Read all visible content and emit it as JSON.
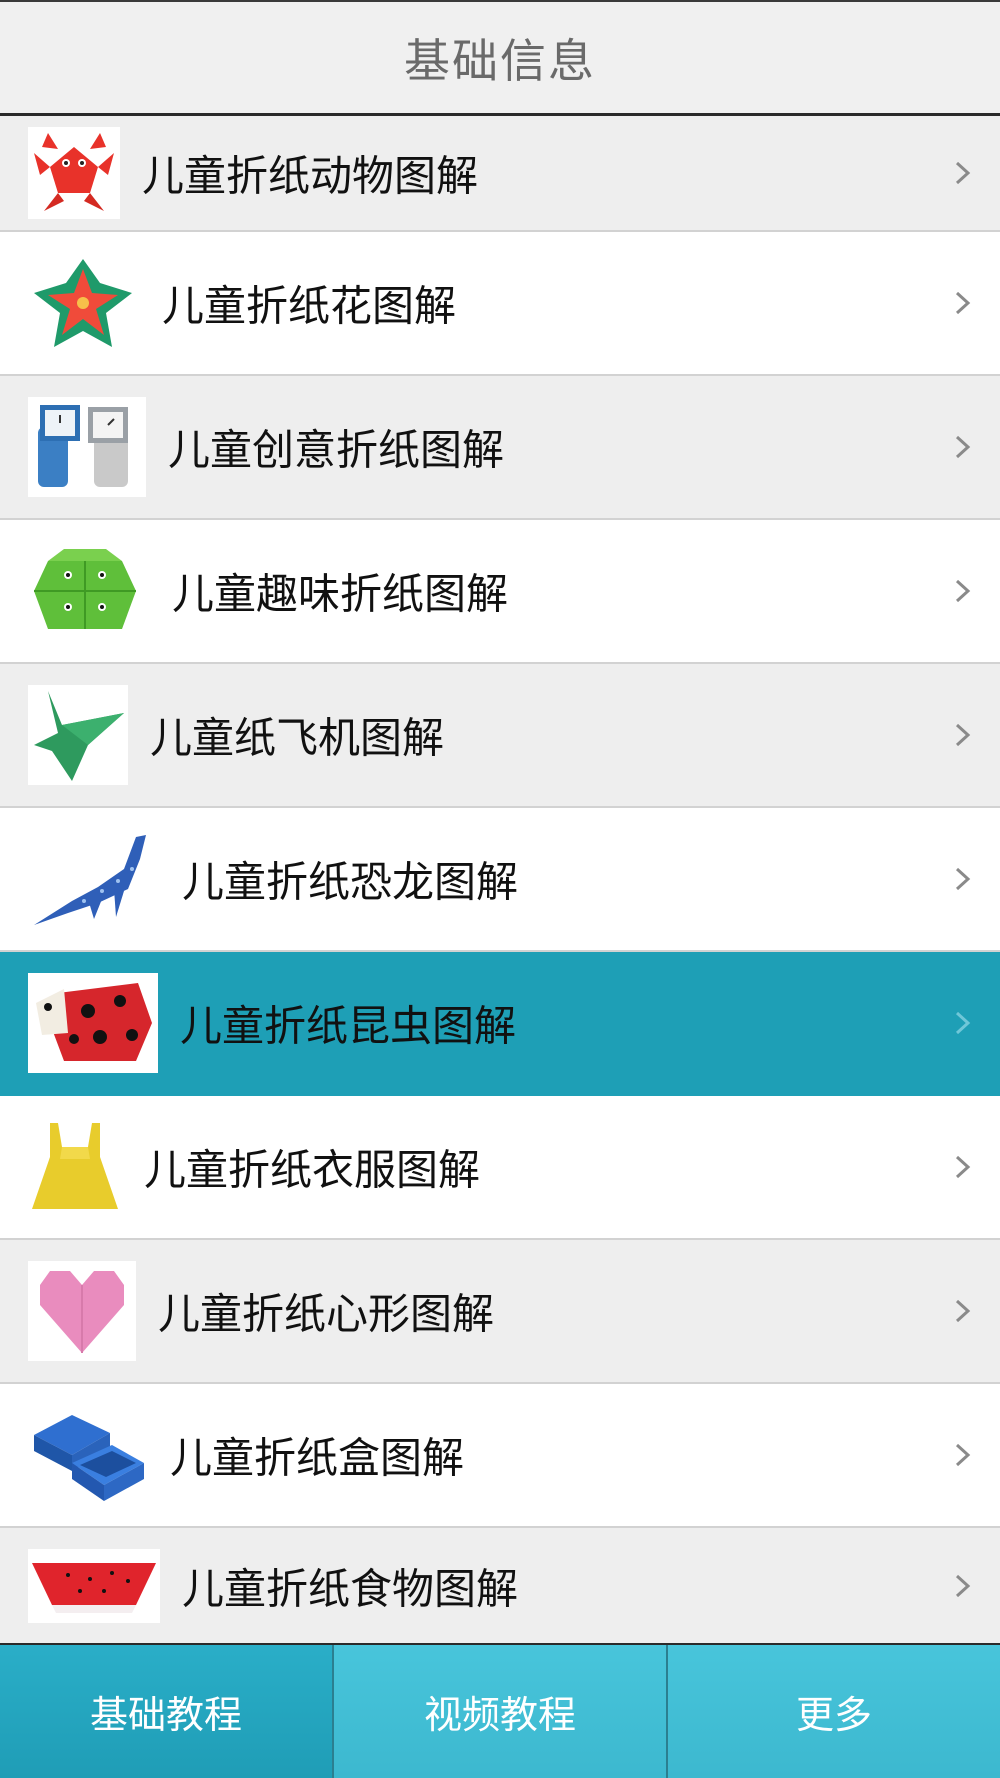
{
  "header": {
    "title": "基础信息"
  },
  "list": {
    "items": [
      {
        "label": "儿童折纸动物图解",
        "icon": "origami-crab-icon"
      },
      {
        "label": "儿童折纸花图解",
        "icon": "origami-flower-icon"
      },
      {
        "label": "儿童创意折纸图解",
        "icon": "origami-watch-icon"
      },
      {
        "label": "儿童趣味折纸图解",
        "icon": "origami-frog-icon"
      },
      {
        "label": "儿童纸飞机图解",
        "icon": "origami-airplane-icon"
      },
      {
        "label": "儿童折纸恐龙图解",
        "icon": "origami-dinosaur-icon"
      },
      {
        "label": "儿童折纸昆虫图解",
        "icon": "origami-ladybug-icon",
        "selected": true
      },
      {
        "label": "儿童折纸衣服图解",
        "icon": "origami-dress-icon"
      },
      {
        "label": "儿童折纸心形图解",
        "icon": "origami-heart-icon"
      },
      {
        "label": "儿童折纸盒图解",
        "icon": "origami-box-icon"
      },
      {
        "label": "儿童折纸食物图解",
        "icon": "origami-watermelon-icon"
      }
    ]
  },
  "tabbar": {
    "tabs": [
      {
        "label": "基础教程",
        "active": true
      },
      {
        "label": "视频教程"
      },
      {
        "label": "更多"
      }
    ]
  },
  "colors": {
    "accent": "#1e9fb6",
    "tab_bg": "#4ac6dc",
    "row_shaded": "#eeeeee"
  }
}
